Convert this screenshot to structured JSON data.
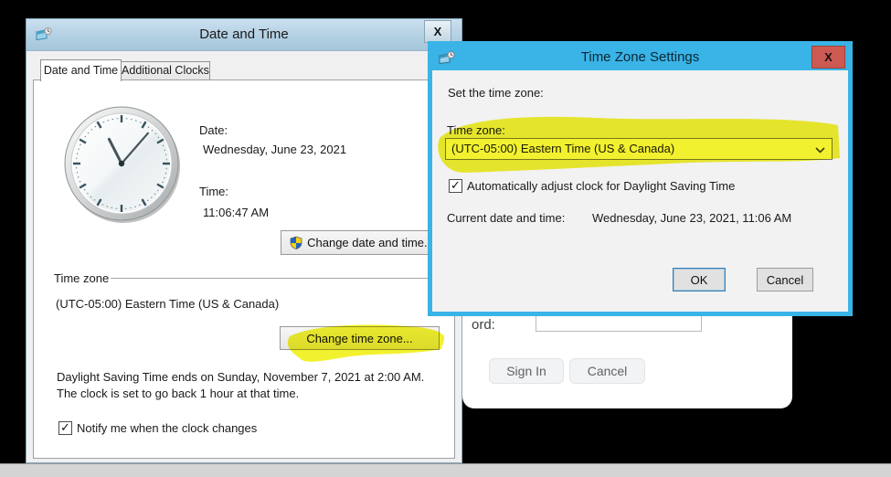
{
  "icons": {
    "close_glyph": "X",
    "check_glyph": "✓"
  },
  "date_time_window": {
    "title": "Date and Time",
    "tabs": [
      {
        "label": "Date and Time"
      },
      {
        "label": "Additional Clocks"
      }
    ],
    "date_label": "Date:",
    "date_value": "Wednesday, June 23, 2021",
    "time_label": "Time:",
    "time_value": "11:06:47 AM",
    "change_date_time_button": "Change date and time...",
    "time_zone_group": "Time zone",
    "time_zone_value": "(UTC-05:00) Eastern Time (US & Canada)",
    "change_time_zone_button": "Change time zone...",
    "dst_text_line1": "Daylight Saving Time ends on Sunday, November 7, 2021 at 2:00 AM.",
    "dst_text_line2": "The clock is set to go back 1 hour at that time.",
    "notify_checkbox_label": "Notify me when the clock changes",
    "notify_checked": true
  },
  "time_zone_window": {
    "title": "Time Zone Settings",
    "set_time_zone_label": "Set the time zone:",
    "time_zone_label": "Time zone:",
    "time_zone_selected": "(UTC-05:00) Eastern Time (US & Canada)",
    "dst_checkbox_label": "Automatically adjust clock for Daylight Saving Time",
    "dst_checked": true,
    "current_date_time_label": "Current date and time:",
    "current_date_time_value": "Wednesday, June 23, 2021, 11:06 AM",
    "ok_button": "OK",
    "cancel_button": "Cancel"
  },
  "signin_panel": {
    "password_label_visible": "ord:",
    "sign_in_button": "Sign In",
    "cancel_button": "Cancel"
  },
  "colors": {
    "tz_titlebar": "#3ab3e6",
    "tz_close_button": "#cd5a52",
    "dt_titlebar": "#b3d0e3",
    "highlighter": "#f0ee0a",
    "taskbar": "#d4d4d4"
  }
}
